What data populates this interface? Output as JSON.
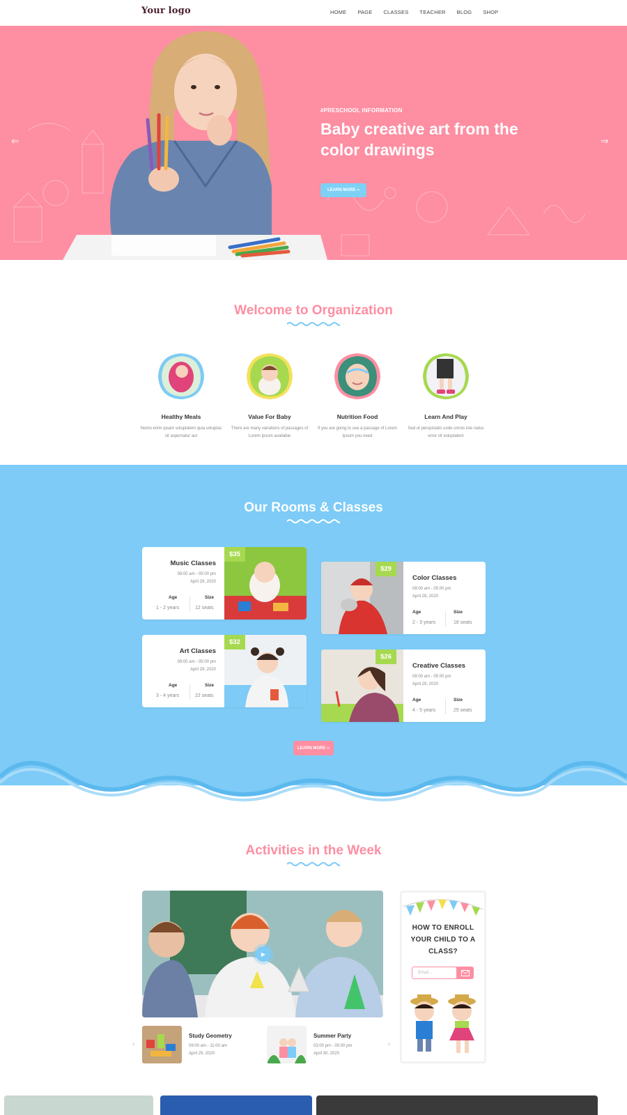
{
  "nav": {
    "logo": "Your logo",
    "items": [
      "HOME",
      "PAGE",
      "CLASSES",
      "TEACHER",
      "BLOG",
      "SHOP"
    ]
  },
  "hero": {
    "tag": "#PRESCHOOL INFORMATION",
    "title": "Baby creative art from the color drawings",
    "button": "LEARN MORE  ››",
    "prev_icon": "arrow-left-icon",
    "next_icon": "arrow-right-icon",
    "background": "#fe8ea2"
  },
  "welcome": {
    "title": "Welcome to Organization",
    "features": [
      {
        "title": "Healthy Meals",
        "desc": "Nemo enim ipsam voluptatem quia voluptas sit aspernatur aut"
      },
      {
        "title": "Value For Baby",
        "desc": "There are many variations of passages of Lorem Ipsum available"
      },
      {
        "title": "Nutrition Food",
        "desc": "If you are going to use a passage of Lorem Ipsum you need"
      },
      {
        "title": "Learn And Play",
        "desc": "Sed ut perspiciatis unde omnis iste natus error sit voluptatem"
      }
    ]
  },
  "rooms": {
    "title": "Our Rooms & Classes",
    "background": "#7dcbf6",
    "button": "LEARN MORE  ››",
    "classes": [
      {
        "name": "Music Classes",
        "price": "$35",
        "time": "08:00 am - 05:00 pm",
        "date": "April 29, 2020",
        "age_label": "Age",
        "age": "1 - 2 years",
        "size_label": "Size",
        "size": "12 seats"
      },
      {
        "name": "Color Classes",
        "price": "$29",
        "time": "08:00 am - 05:00 pm",
        "date": "April 29, 2020",
        "age_label": "Age",
        "age": "2 - 3 years",
        "size_label": "Size",
        "size": "18 seats"
      },
      {
        "name": "Art Classes",
        "price": "$32",
        "time": "08:00 am - 05:00 pm",
        "date": "April 29, 2020",
        "age_label": "Age",
        "age": "3 - 4 years",
        "size_label": "Size",
        "size": "22 seats"
      },
      {
        "name": "Creative Classes",
        "price": "$26",
        "time": "08:00 am - 05:00 pm",
        "date": "April 29, 2020",
        "age_label": "Age",
        "age": "4 - 5 years",
        "size_label": "Size",
        "size": "25 seats"
      }
    ]
  },
  "activities": {
    "title": "Activities in the Week",
    "play_icon": "play-icon",
    "items": [
      {
        "name": "Study Geometry",
        "time": "09:00 am - 11:00 am",
        "date": "April 29, 2020"
      },
      {
        "name": "Summer Party",
        "time": "03:00 pm - 05:00 pm",
        "date": "April 30, 2020"
      }
    ],
    "enroll": {
      "title": "HOW TO ENROLL YOUR CHILD TO A CLASS?",
      "email_placeholder": "Email...",
      "send_icon": "mail-icon"
    }
  },
  "colors": {
    "pink": "#fe8ea2",
    "blue": "#7dcbf6",
    "green": "#a6d94f"
  }
}
